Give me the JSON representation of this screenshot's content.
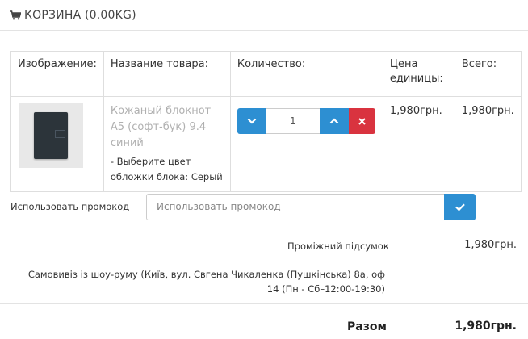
{
  "header": {
    "title": "КОРЗИНА (0.00KG)",
    "icon": "cart-icon"
  },
  "table": {
    "columns": [
      "Изображение:",
      "Название товара:",
      "Количество:",
      "Цена единицы:",
      "Всего:"
    ],
    "rows": [
      {
        "name": "Кожаный блокнот А5 (софт-бук) 9.4 синий",
        "option": " - Выберите цвет обложки блока: Серый",
        "quantity": "1",
        "unit_price": "1,980грн.",
        "total": "1,980грн."
      }
    ]
  },
  "promo": {
    "label": "Использовать промокод",
    "placeholder": "Использовать промокод"
  },
  "summary": {
    "subtotal_label": "Проміжний підсумок",
    "subtotal_value": "1,980грн.",
    "shipping_label": "Самовивіз із шоу-руму (Київ, вул. Євгена Чикаленка (Пушкінська) 8а, оф 14 (Пн - Сб–12:00-19:30)",
    "total_label": "Разом",
    "total_value": "1,980грн."
  },
  "colors": {
    "accent": "#2d8fd2",
    "danger": "#d9333f",
    "product_name": "#b0b0b0"
  }
}
